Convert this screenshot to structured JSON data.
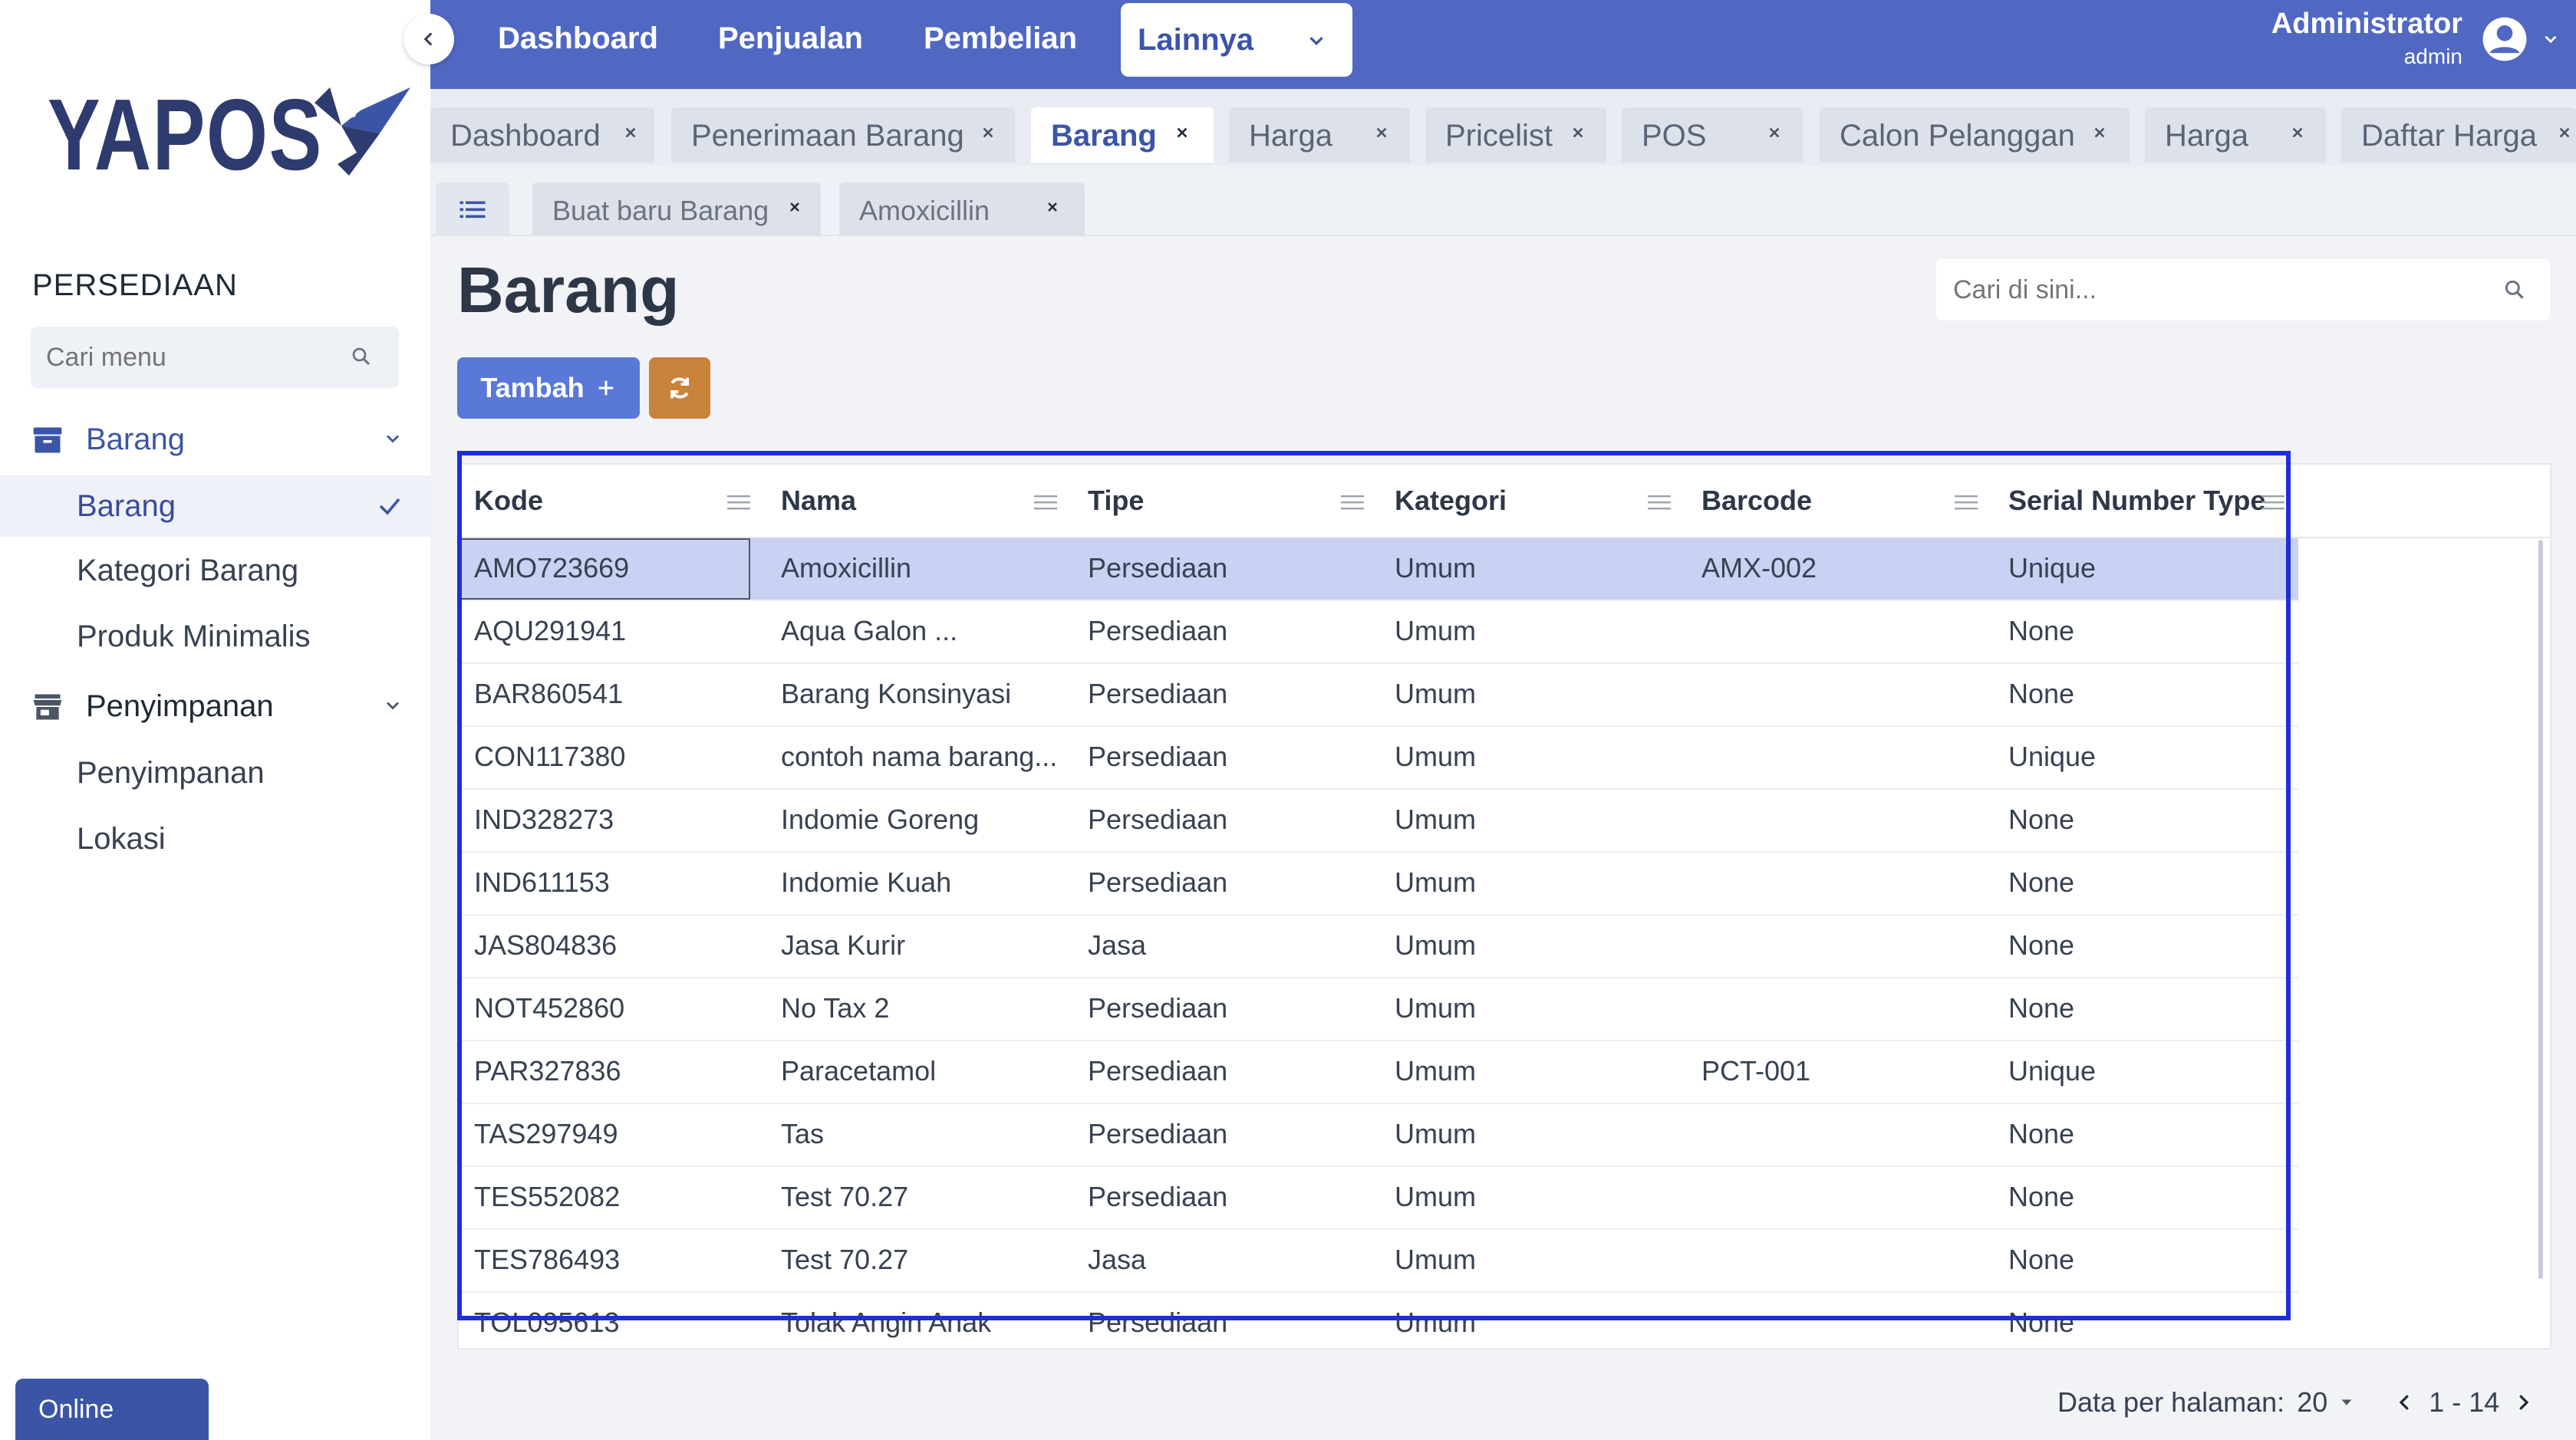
{
  "app": {
    "logo_text": "YAPOS"
  },
  "sidebar": {
    "section_title": "PERSEDIAAN",
    "search_placeholder": "Cari menu",
    "groups": [
      {
        "label": "Barang",
        "items": [
          "Barang",
          "Kategori Barang",
          "Produk Minimalis"
        ]
      },
      {
        "label": "Penyimpanan",
        "items": [
          "Penyimpanan",
          "Lokasi"
        ]
      }
    ],
    "status": "Online"
  },
  "topnav": {
    "items": [
      "Dashboard",
      "Penjualan",
      "Pembelian"
    ],
    "more_label": "Lainnya",
    "user_name": "Administrator",
    "user_role": "admin"
  },
  "tabs": [
    "Dashboard",
    "Penerimaan Barang",
    "Barang",
    "Harga",
    "Pricelist",
    "POS",
    "Calon Pelanggan",
    "Harga",
    "Daftar Harga"
  ],
  "active_tab": "Barang",
  "subtabs": [
    "Buat baru Barang",
    "Amoxicillin"
  ],
  "page": {
    "title": "Barang",
    "search_placeholder": "Cari di sini...",
    "add_label": "Tambah",
    "add_icon": "plus-icon"
  },
  "table": {
    "columns": [
      "Kode",
      "Nama",
      "Tipe",
      "Kategori",
      "Barcode",
      "Serial Number Type"
    ],
    "rows": [
      [
        "AMO723669",
        "Amoxicillin",
        "Persediaan",
        "Umum",
        "AMX-002",
        "Unique"
      ],
      [
        "AQU291941",
        "Aqua Galon ...",
        "Persediaan",
        "Umum",
        "",
        "None"
      ],
      [
        "BAR860541",
        "Barang Konsinyasi",
        "Persediaan",
        "Umum",
        "",
        "None"
      ],
      [
        "CON117380",
        "contoh nama barang...",
        "Persediaan",
        "Umum",
        "",
        "Unique"
      ],
      [
        "IND328273",
        "Indomie Goreng",
        "Persediaan",
        "Umum",
        "",
        "None"
      ],
      [
        "IND611153",
        "Indomie Kuah",
        "Persediaan",
        "Umum",
        "",
        "None"
      ],
      [
        "JAS804836",
        "Jasa Kurir",
        "Jasa",
        "Umum",
        "",
        "None"
      ],
      [
        "NOT452860",
        "No Tax 2",
        "Persediaan",
        "Umum",
        "",
        "None"
      ],
      [
        "PAR327836",
        "Paracetamol",
        "Persediaan",
        "Umum",
        "PCT-001",
        "Unique"
      ],
      [
        "TAS297949",
        "Tas",
        "Persediaan",
        "Umum",
        "",
        "None"
      ],
      [
        "TES552082",
        "Test 70.27",
        "Persediaan",
        "Umum",
        "",
        "None"
      ],
      [
        "TES786493",
        "Test 70.27",
        "Jasa",
        "Umum",
        "",
        "None"
      ],
      [
        "TOL095613",
        "Tolak Angin Anak",
        "Persediaan",
        "Umum",
        "",
        "None"
      ]
    ]
  },
  "pager": {
    "label": "Data per halaman:",
    "page_size": "20",
    "range": "1 - 14"
  },
  "colors": {
    "topbar": "#5068c2",
    "accent": "#3b55a6",
    "selected_row": "#c8d2f3",
    "refresh_button": "#c9823a",
    "highlight": "#1d2fd9"
  }
}
